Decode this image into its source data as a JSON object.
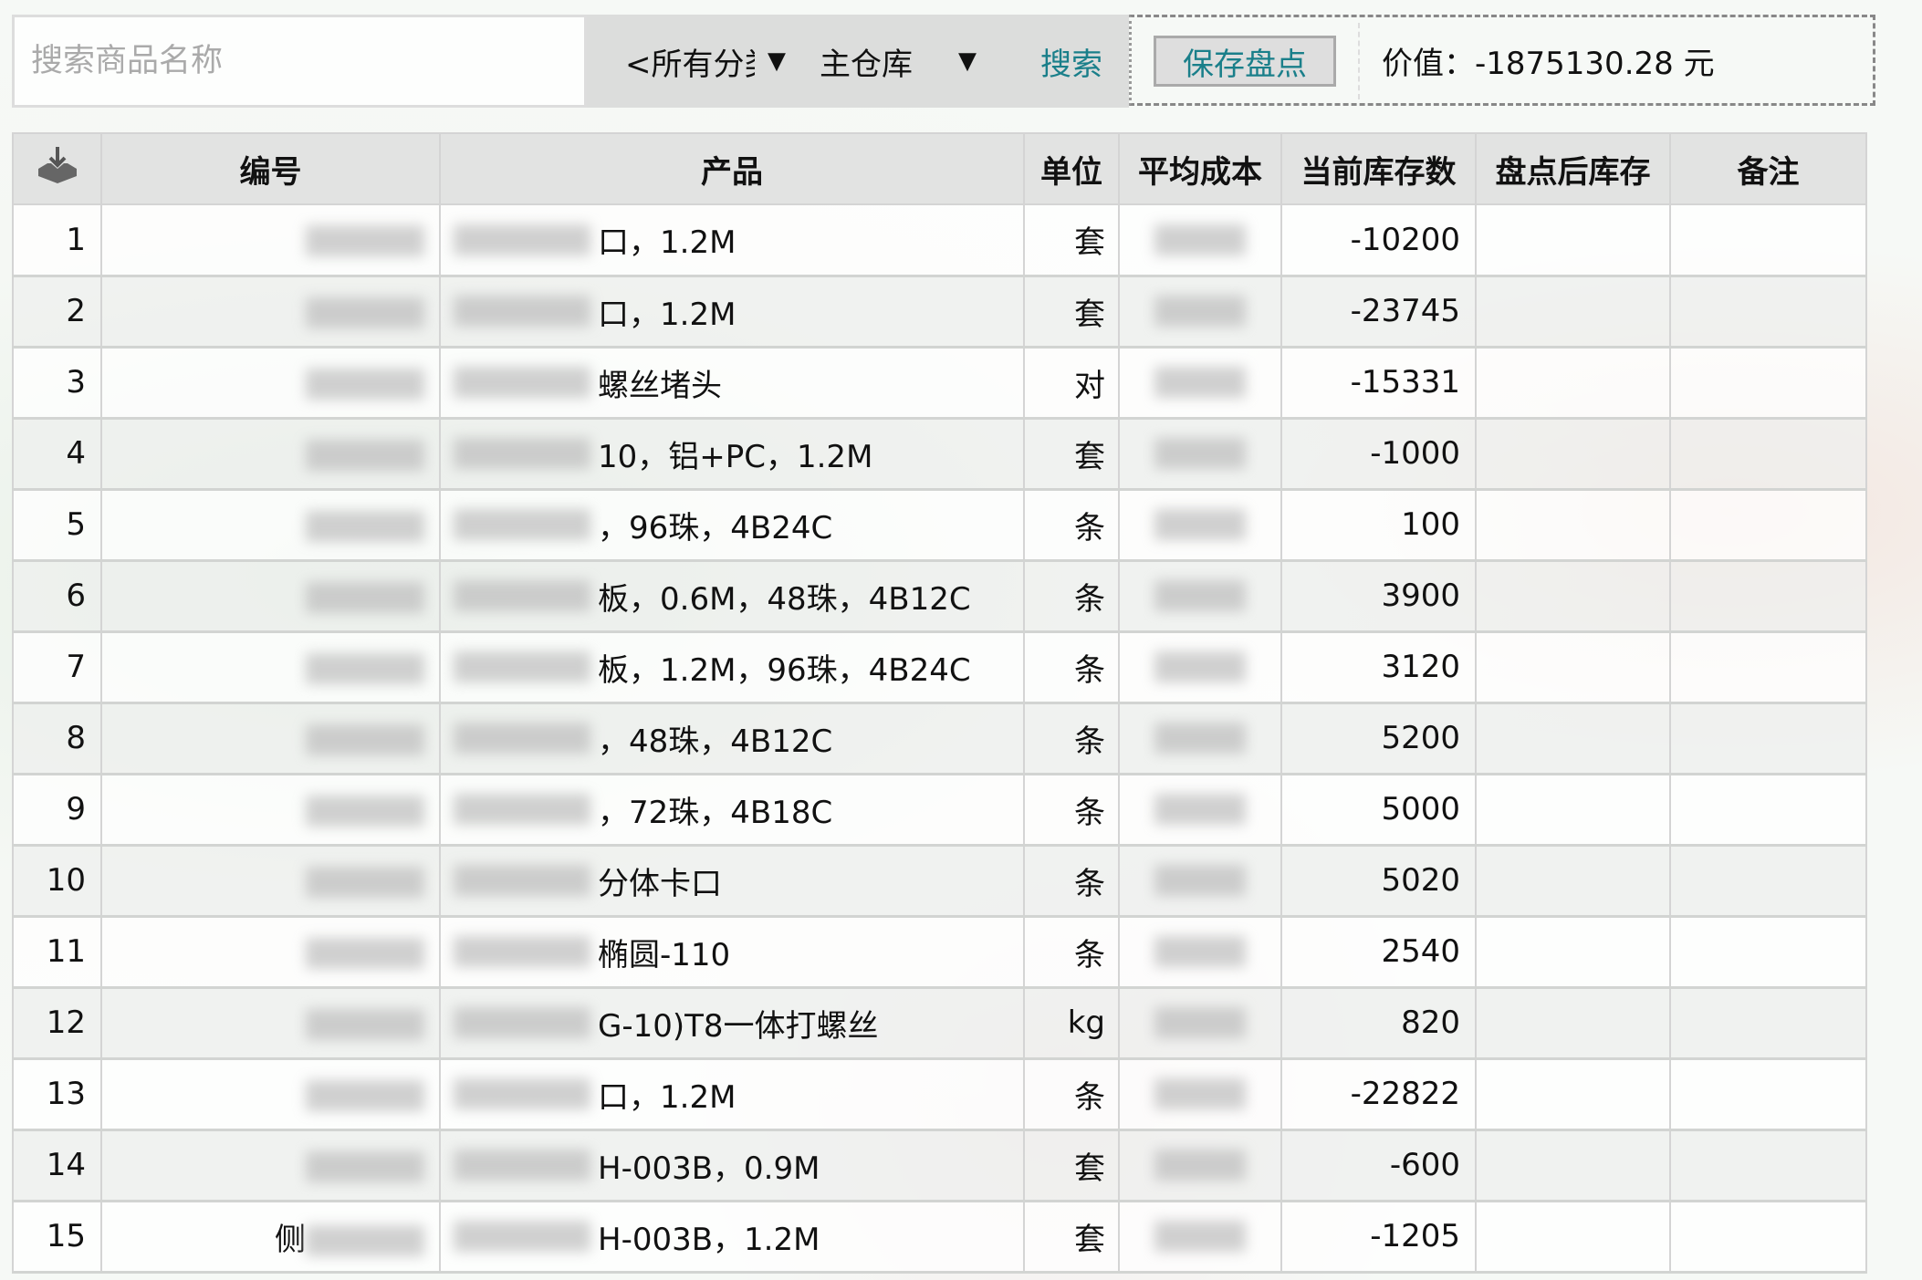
{
  "toolbar": {
    "search_placeholder": "搜索商品名称",
    "category_select": "<所有分类",
    "warehouse_select": "主仓库",
    "search_label": "搜索",
    "save_label": "保存盘点",
    "value_text": "价值：-1875130.28 元"
  },
  "table": {
    "headers": [
      "编号",
      "产品",
      "单位",
      "平均成本",
      "当前库存数",
      "盘点后库存",
      "备注"
    ],
    "header_icon": "download-tray-icon",
    "rows": [
      {
        "no": "1",
        "code": "",
        "product": "口，1.2M",
        "unit": "套",
        "stock": "-10200"
      },
      {
        "no": "2",
        "code": "",
        "product": "口，1.2M",
        "unit": "套",
        "stock": "-23745"
      },
      {
        "no": "3",
        "code": "",
        "product": "螺丝堵头",
        "unit": "对",
        "stock": "-15331"
      },
      {
        "no": "4",
        "code": "",
        "product": "10，铝+PC，1.2M",
        "unit": "套",
        "stock": "-1000"
      },
      {
        "no": "5",
        "code": "",
        "product": "，96珠，4B24C",
        "unit": "条",
        "stock": "100"
      },
      {
        "no": "6",
        "code": "",
        "product": "板，0.6M，48珠，4B12C",
        "unit": "条",
        "stock": "3900"
      },
      {
        "no": "7",
        "code": "",
        "product": "板，1.2M，96珠，4B24C",
        "unit": "条",
        "stock": "3120"
      },
      {
        "no": "8",
        "code": "",
        "product": "，48珠，4B12C",
        "unit": "条",
        "stock": "5200"
      },
      {
        "no": "9",
        "code": "",
        "product": "，72珠，4B18C",
        "unit": "条",
        "stock": "5000"
      },
      {
        "no": "10",
        "code": "",
        "product": "分体卡口",
        "unit": "条",
        "stock": "5020"
      },
      {
        "no": "11",
        "code": "",
        "product": "椭圆-110",
        "unit": "条",
        "stock": "2540"
      },
      {
        "no": "12",
        "code": "",
        "product": "G-10)T8一体打螺丝",
        "unit": "kg",
        "stock": "820"
      },
      {
        "no": "13",
        "code": "",
        "product": "口，1.2M",
        "unit": "条",
        "stock": "-22822"
      },
      {
        "no": "14",
        "code": "",
        "product": "H-003B，0.9M",
        "unit": "套",
        "stock": "-600"
      },
      {
        "no": "15",
        "code": "侧",
        "product": "H-003B，1.2M",
        "unit": "套",
        "stock": "-1205"
      }
    ]
  },
  "colors": {
    "accent": "#1a7f8a",
    "header_bg": "#e2e3e2"
  }
}
